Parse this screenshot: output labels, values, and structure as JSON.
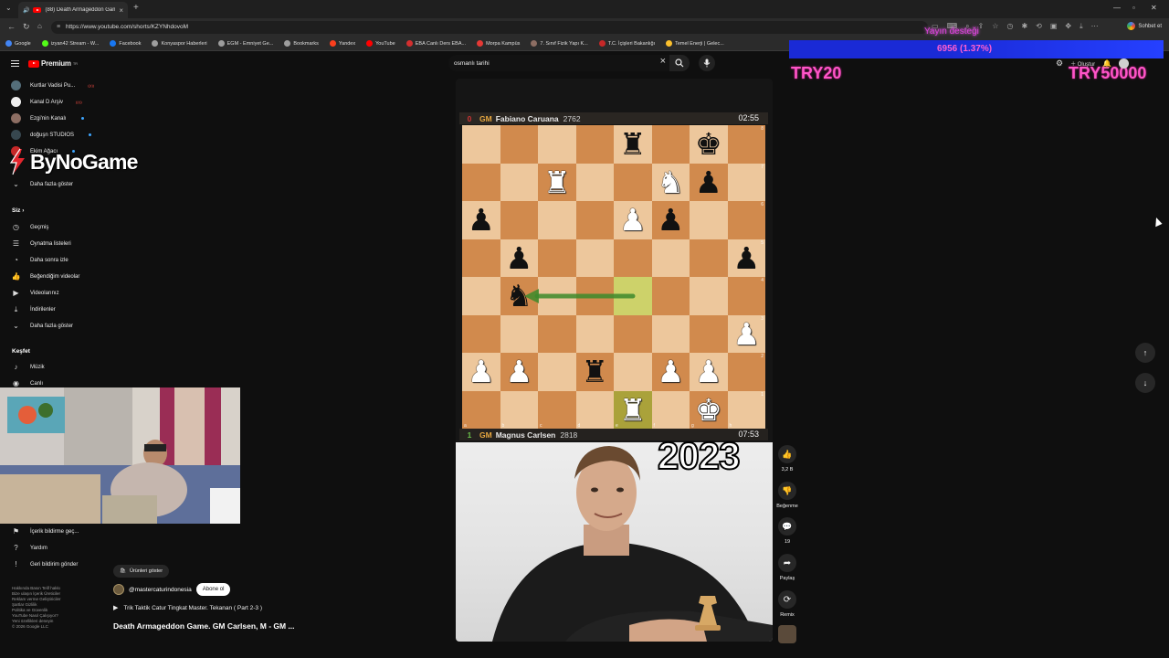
{
  "browser": {
    "tab_title": "(88) Death Armageddon Game.",
    "url": "https://www.youtube.com/shorts/KZYNhdovoM",
    "bookmarks": [
      {
        "label": "Google",
        "color": "#4285f4"
      },
      {
        "label": "izyan42 Stream - W...",
        "color": "#53fc18"
      },
      {
        "label": "Facebook",
        "color": "#1877f2"
      },
      {
        "label": "Konyaspor Haberleri",
        "color": "#9e9e9e"
      },
      {
        "label": "EGM - Emniyet Ge...",
        "color": "#9e9e9e"
      },
      {
        "label": "Bookmarks",
        "color": "#9e9e9e"
      },
      {
        "label": "Yandex",
        "color": "#fc3f1d"
      },
      {
        "label": "YouTube",
        "color": "#ff0000"
      },
      {
        "label": "EBA Canlı Ders EBA...",
        "color": "#d32f2f"
      },
      {
        "label": "Morpa Kampüs",
        "color": "#e53935"
      },
      {
        "label": "7. Sınıf Fizik Yapı K...",
        "color": "#8d6e63"
      },
      {
        "label": "T.C. İçişleri Bakanlığı",
        "color": "#c62828"
      },
      {
        "label": "Temel Enerji | Gelec...",
        "color": "#fbc02d"
      }
    ],
    "chat_label": "Sohbet et"
  },
  "youtube": {
    "logo_text": "Premium",
    "logo_badge": "TR",
    "subscriptions": [
      {
        "label": "Kurtlar Vadisi Pu...",
        "color": "#546e7a",
        "live": true
      },
      {
        "label": "Kanal D Arşiv",
        "color": "#eeeeee",
        "live": true
      },
      {
        "label": "Ezgi'nin Kanalı",
        "color": "#8d6e63",
        "dot": true
      },
      {
        "label": "doğuşn STUDIOS",
        "color": "#37474f",
        "dot": true
      },
      {
        "label": "Ekim Ağacı",
        "color": "#c62828",
        "dot": true
      }
    ],
    "show_more": "Daha fazla göster",
    "you_header": "Siz",
    "you_items": [
      {
        "label": "Geçmiş",
        "icon": "history-icon"
      },
      {
        "label": "Oynatma listeleri",
        "icon": "playlist-icon"
      },
      {
        "label": "Daha sonra izle",
        "icon": "clock-icon"
      },
      {
        "label": "Beğendiğim videolar",
        "icon": "thumb-up-icon"
      },
      {
        "label": "Videolarınız",
        "icon": "video-icon"
      },
      {
        "label": "İndirilenler",
        "icon": "download-icon"
      }
    ],
    "show_more_2": "Daha fazla göster",
    "explore_header": "Keşfet",
    "explore_items": [
      {
        "label": "Müzik",
        "icon": "music-icon"
      },
      {
        "label": "Canlı",
        "icon": "live-icon"
      }
    ],
    "bottom_items": [
      {
        "label": "İçerik bildirme geç...",
        "icon": "flag-icon"
      },
      {
        "label": "Yardım",
        "icon": "help-icon"
      },
      {
        "label": "Geri bildirim gönder",
        "icon": "feedback-icon"
      }
    ],
    "footer": [
      "Hakkında  Basın  Telif hakkı",
      "Bize ulaşın  İçerik Üreticiler",
      "Reklam verme  Geliştiriciler",
      "",
      "Şartlar  Gizlilik",
      "Politika ve Güvenlik",
      "YouTube Nasıl Çalışıyor?",
      "Yeni özellikleri deneyin",
      "",
      "© 2026 Google LLC"
    ],
    "search_value": "osmanlı tarihi",
    "top_right_create": "Oluştur"
  },
  "overlay": {
    "brand": "ByNoGame",
    "donation_title": "Yayın desteği",
    "donation_progress": "6956 (1.37%)",
    "try_left": "TRY20",
    "try_right": "TRY50000"
  },
  "short": {
    "top_player": {
      "flag": "0",
      "title": "GM",
      "name": "Fabiano Caruana",
      "rating": "2762",
      "clock": "02:55"
    },
    "bottom_player": {
      "flag": "1",
      "title": "GM",
      "name": "Magnus Carlsen",
      "rating": "2818",
      "clock": "07:53"
    },
    "year_text": "2023",
    "files": [
      "a",
      "b",
      "c",
      "d",
      "e",
      "f",
      "g",
      "h"
    ],
    "ranks": [
      "8",
      "7",
      "6",
      "5",
      "4",
      "3",
      "2",
      "1"
    ],
    "board": [
      [
        "",
        "",
        "",
        "",
        "bR",
        "",
        "bK",
        ""
      ],
      [
        "",
        "",
        "wR",
        "",
        "",
        "wN",
        "bP",
        ""
      ],
      [
        "bP",
        "",
        "",
        "",
        "wP",
        "bP",
        "",
        ""
      ],
      [
        "",
        "bP",
        "",
        "",
        "",
        "",
        "",
        "bP"
      ],
      [
        "",
        "bN",
        "",
        "",
        "",
        "",
        "",
        ""
      ],
      [
        "",
        "",
        "",
        "",
        "",
        "",
        "",
        "wP"
      ],
      [
        "wP",
        "wP",
        "",
        "bR",
        "",
        "wP",
        "wP",
        ""
      ],
      [
        "",
        "",
        "",
        "",
        "wR",
        "",
        "wK",
        ""
      ]
    ],
    "highlights": [
      "e4",
      "e1"
    ],
    "arrow_move": "e4-b4",
    "products_label": "Ürünleri göster",
    "channel_handle": "@mastercaturindonesia",
    "subscribe_label": "Abone ol",
    "playlist_label": "Trik Taktik Catur Tingkat Master. Tekanan ( Part 2-3 )",
    "title": "Death Armageddon Game. GM Carlsen, M - GM ..."
  },
  "actions": {
    "likes": "3,2 B",
    "dislike": "Beğenme",
    "comments": "19",
    "share": "Paylaş",
    "remix": "Remix"
  }
}
